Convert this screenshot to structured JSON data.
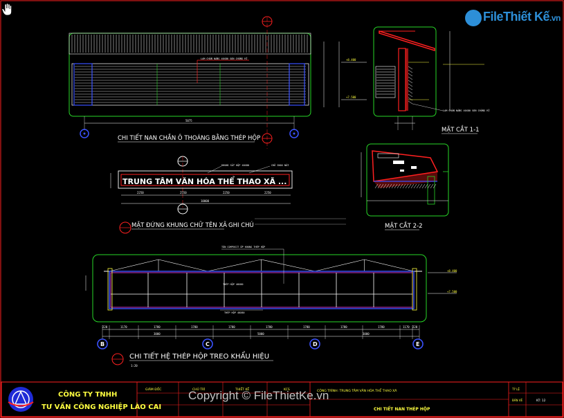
{
  "watermark": {
    "brand": "File",
    "brand2": "Thiết Kế",
    "domain": ".vn"
  },
  "copyright": "Copyright © FileThietKe.vn",
  "views": {
    "top_title": "CHI TIẾT NAN CHẮN Ô THOÁNG BẰNG THÉP HỘP",
    "top_note": "LAM CHẮN NẮNG 40X80 SƠN CHỐNG RỈ",
    "top_dims": [
      "5075"
    ],
    "top_levels": [
      "+8.400",
      "+7.500"
    ],
    "section11_title": "MẶT CẮT 1-1",
    "section11_note": "LAM CHẮN NẮNG 40X80 SƠN CHỐNG RỈ",
    "section22_title": "MẶT CẮT 2-2",
    "sign_text": "TRUNG TÂM VĂN HÓA THỂ THAO XÃ ...",
    "sign_title": "MẶT ĐỨNG KHUNG CHỮ TÊN XÃ",
    "sign_note_label": "GHI CHÚ",
    "sign_note_1": "KHUNG SẮT HỘP 40X80",
    "sign_note_2": "CHỮ INOX NỔI",
    "sign_dims": [
      "2250",
      "2550",
      "2250",
      "2250"
    ],
    "sign_total": "10000",
    "frame_title": "CHI TIẾT HỆ THÉP HỘP TREO KHẨU HIỆU",
    "frame_note_top": "TÔN COMPOSIT ỐP KHUNG THÉP HỘP",
    "frame_note_mid": "THÉP HỘP 40X80",
    "frame_note_bot": "THÉP HỘP 40X80",
    "frame_scale": "1:20",
    "frame_dims": [
      "220",
      "1170",
      "1780",
      "1780",
      "1780",
      "1780",
      "1780",
      "1780",
      "1780",
      "1170",
      "220"
    ],
    "frame_spans": [
      "3000",
      "5000",
      "3000"
    ],
    "frame_levels": [
      "+8.400",
      "+7.500"
    ],
    "axis_labels": [
      "B",
      "C",
      "D",
      "E"
    ]
  },
  "title_block": {
    "company_1": "CÔNG TY TNHH",
    "company_2": "TƯ VẤN CÔNG NGHIỆP LÀO CAI",
    "roles": [
      "GIÁM ĐỐC",
      "CHỦ TRÌ",
      "THIẾT KẾ",
      "KCS"
    ],
    "project": "CÔNG TRÌNH: TRUNG TÂM VĂN HÓA THỂ THAO XÃ",
    "drawing_title": "CHI TIẾT NAN THÉP HỘP",
    "right_labels": [
      "TỶ LỆ",
      "BẢN VẼ",
      "KT: 12"
    ]
  },
  "colors": {
    "red": "#ff2020",
    "green": "#27d827",
    "yellow": "#ffff40",
    "blue": "#3a52ff",
    "cyan": "#00e5e5",
    "magenta": "#ff40ff",
    "white": "#ffffff"
  }
}
